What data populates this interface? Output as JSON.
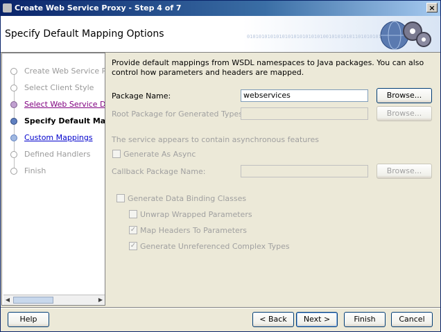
{
  "window": {
    "title": "Create Web Service Proxy - Step 4 of 7",
    "close_glyph": "×"
  },
  "header": {
    "title": "Specify Default Mapping Options",
    "binary": "01010101010101010101010101001010101011010101011010"
  },
  "sidebar": {
    "steps": [
      {
        "label": "Create Web Service Proxy",
        "state": "disabled"
      },
      {
        "label": "Select Client Style",
        "state": "disabled"
      },
      {
        "label": "Select Web Service Description",
        "state": "visited"
      },
      {
        "label": "Specify Default Mapping Options",
        "state": "current"
      },
      {
        "label": "Custom Mappings",
        "state": "link"
      },
      {
        "label": "Defined Handlers",
        "state": "disabled"
      },
      {
        "label": "Finish",
        "state": "disabled"
      }
    ],
    "scroll_left": "◀",
    "scroll_right": "▶"
  },
  "main": {
    "description": "Provide default mappings from WSDL namespaces to Java packages. You can also control how parameters and headers are mapped.",
    "package_name_label": "Package Name:",
    "package_name_value": "webservices",
    "root_package_label": "Root Package for Generated Types:",
    "root_package_value": "",
    "async_note": "The service appears to contain asynchronous features",
    "generate_async_label": "Generate As Async",
    "callback_label": "Callback Package Name:",
    "callback_value": "",
    "browse_label": "Browse...",
    "data_binding_label": "Generate Data Binding Classes",
    "unwrap_label": "Unwrap Wrapped Parameters",
    "map_headers_label": "Map Headers To Parameters",
    "unreferenced_label": "Generate Unreferenced Complex Types",
    "check_glyph": "✓"
  },
  "footer": {
    "help": "Help",
    "back": "< Back",
    "next": "Next >",
    "finish": "Finish",
    "cancel": "Cancel"
  }
}
